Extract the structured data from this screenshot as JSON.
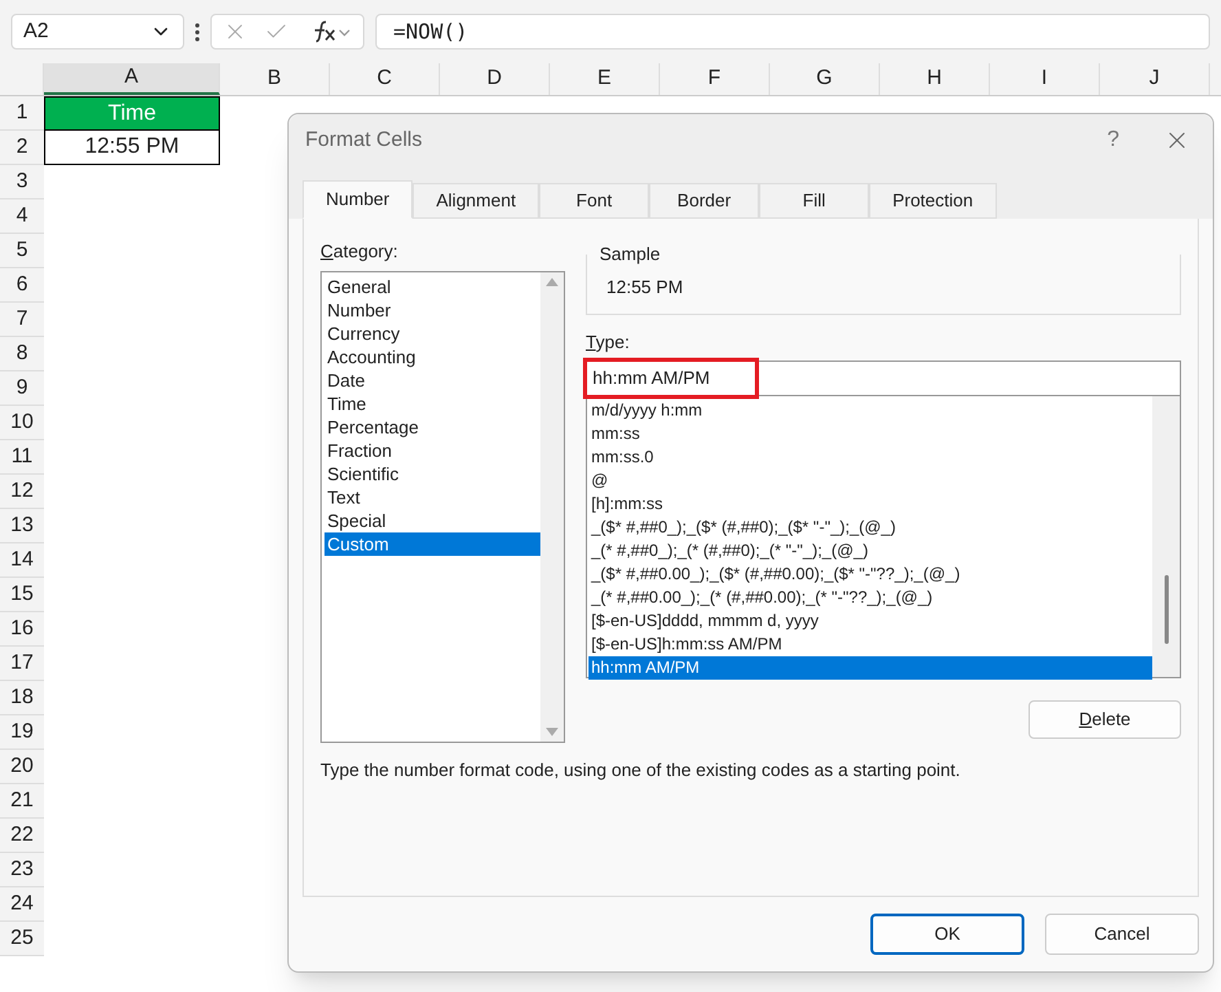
{
  "formula_bar": {
    "name_box": "A2",
    "formula": "=NOW()"
  },
  "sheet": {
    "columns": [
      {
        "label": "A",
        "selected": true
      },
      {
        "label": "B",
        "selected": false
      },
      {
        "label": "C",
        "selected": false
      },
      {
        "label": "D",
        "selected": false
      },
      {
        "label": "E",
        "selected": false
      },
      {
        "label": "F",
        "selected": false
      },
      {
        "label": "G",
        "selected": false
      },
      {
        "label": "H",
        "selected": false
      },
      {
        "label": "I",
        "selected": false
      },
      {
        "label": "J",
        "selected": false
      }
    ],
    "rows": [
      "1",
      "2",
      "3",
      "4",
      "5",
      "6",
      "7",
      "8",
      "9",
      "10",
      "11",
      "12",
      "13",
      "14",
      "15",
      "16",
      "17",
      "18",
      "19",
      "20",
      "21",
      "22",
      "23",
      "24",
      "25"
    ],
    "cells": [
      {
        "text": "Time",
        "kind": "header"
      },
      {
        "text": "12:55 PM",
        "kind": "value"
      }
    ]
  },
  "dialog": {
    "title": "Format Cells",
    "help": "?",
    "tabs": [
      {
        "label": "Number",
        "selected": true
      },
      {
        "label": "Alignment",
        "selected": false
      },
      {
        "label": "Font",
        "selected": false
      },
      {
        "label": "Border",
        "selected": false
      },
      {
        "label": "Fill",
        "selected": false
      },
      {
        "label": "Protection",
        "selected": false
      }
    ],
    "category_label": "Category:",
    "categories": [
      {
        "label": "General",
        "selected": false
      },
      {
        "label": "Number",
        "selected": false
      },
      {
        "label": "Currency",
        "selected": false
      },
      {
        "label": "Accounting",
        "selected": false
      },
      {
        "label": "Date",
        "selected": false
      },
      {
        "label": "Time",
        "selected": false
      },
      {
        "label": "Percentage",
        "selected": false
      },
      {
        "label": "Fraction",
        "selected": false
      },
      {
        "label": "Scientific",
        "selected": false
      },
      {
        "label": "Text",
        "selected": false
      },
      {
        "label": "Special",
        "selected": false
      },
      {
        "label": "Custom",
        "selected": true
      }
    ],
    "sample_label": "Sample",
    "sample": "12:55 PM",
    "type_label": "Type:",
    "type_value": "hh:mm AM/PM",
    "formats": [
      {
        "label": "m/d/yyyy h:mm",
        "selected": false
      },
      {
        "label": "mm:ss",
        "selected": false
      },
      {
        "label": "mm:ss.0",
        "selected": false
      },
      {
        "label": "@",
        "selected": false
      },
      {
        "label": "[h]:mm:ss",
        "selected": false
      },
      {
        "label": "_($* #,##0_);_($* (#,##0);_($* \"-\"_);_(@_)",
        "selected": false
      },
      {
        "label": "_(* #,##0_);_(* (#,##0);_(* \"-\"_);_(@_)",
        "selected": false
      },
      {
        "label": "_($* #,##0.00_);_($* (#,##0.00);_($* \"-\"??_);_(@_)",
        "selected": false
      },
      {
        "label": "_(* #,##0.00_);_(* (#,##0.00);_(* \"-\"??_);_(@_)",
        "selected": false
      },
      {
        "label": "[$-en-US]dddd, mmmm d, yyyy",
        "selected": false
      },
      {
        "label": "[$-en-US]h:mm:ss AM/PM",
        "selected": false
      },
      {
        "label": "hh:mm AM/PM",
        "selected": true
      }
    ],
    "delete_button": "Delete",
    "hint": "Type the number format code, using one of the existing codes as a starting point.",
    "ok_button": "OK",
    "cancel_button": "Cancel"
  }
}
